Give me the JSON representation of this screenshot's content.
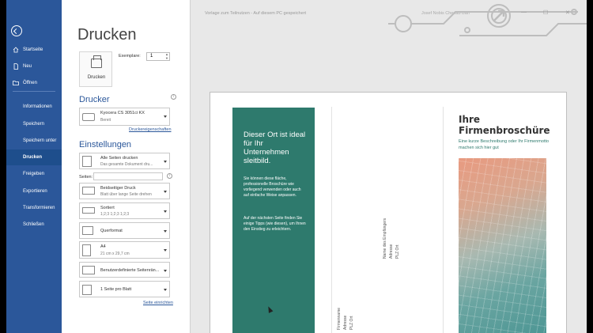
{
  "window": {
    "doc_title": "Vorlage zum Teilnutzen - Auf diesem PC gespeichert",
    "user_name": "Josef Nobis Chenab Ban"
  },
  "nav": {
    "items": [
      {
        "label": "Startseite",
        "icon": "home-icon"
      },
      {
        "label": "Neu",
        "icon": "new-document-icon"
      },
      {
        "label": "Öffnen",
        "icon": "open-folder-icon"
      },
      {
        "label": "Informationen"
      },
      {
        "label": "Speichern"
      },
      {
        "label": "Speichern unter"
      },
      {
        "label": "Drucken"
      },
      {
        "label": "Freigeben"
      },
      {
        "label": "Exportieren"
      },
      {
        "label": "Transformieren"
      },
      {
        "label": "Schließen"
      }
    ],
    "active": "Drucken"
  },
  "print": {
    "title": "Drucken",
    "print_button": "Drucken",
    "copies_label": "Exemplare:",
    "copies_value": "1",
    "printer_heading": "Drucker",
    "printer_name": "Kyocera CS 3051ci KX",
    "printer_status": "Bereit",
    "printer_props_link": "Druckereigenschaften",
    "settings_heading": "Einstellungen",
    "settings": [
      {
        "t1": "Alle Seiten drucken",
        "t2": "Das gesamte Dokument dru..."
      },
      {
        "t1": "Beidseitiger Druck",
        "t2": "Blatt über lange Seite drehen"
      },
      {
        "t1": "Sortiert",
        "t2": "1;2;3    1;2;3    1;2;3"
      },
      {
        "t1": "Querformat",
        "t2": ""
      },
      {
        "t1": "A4",
        "t2": "21 cm x 29,7 cm"
      },
      {
        "t1": "Benutzerdefinierte Seitenrän...",
        "t2": ""
      },
      {
        "t1": "1 Seite pro Blatt",
        "t2": ""
      }
    ],
    "pages_label": "Seiten:",
    "page_setup_link": "Seite einrichten"
  },
  "preview": {
    "panel_heading": "Dieser Ort ist ideal für Ihr Unternehmen sleitbild.",
    "panel_p1": "Sie können diese fläche, professionelle Broschüre wie vorliegend verwenden oder auch auf einfache Weise anpassen.",
    "panel_p2": "Auf der nächsten Seite finden Sie einige Tipps (wie diesen), um Ihnen den Einstieg zu erleichtern.",
    "recipient_name": "Name des Empfängers",
    "recipient_address": "Adresse",
    "recipient_city": "PLZ Ort",
    "return_name": "Firmenname",
    "return_address": "Adresse",
    "return_city": "PLZ Ort",
    "brochure_title": "Ihre Firmenbroschüre",
    "brochure_tagline": "Eine kurze Beschreibung oder Ihr Firmenmotto machen sich hier gut"
  },
  "colors": {
    "nav_blue": "#2b579a",
    "teal": "#2e7a6d"
  }
}
